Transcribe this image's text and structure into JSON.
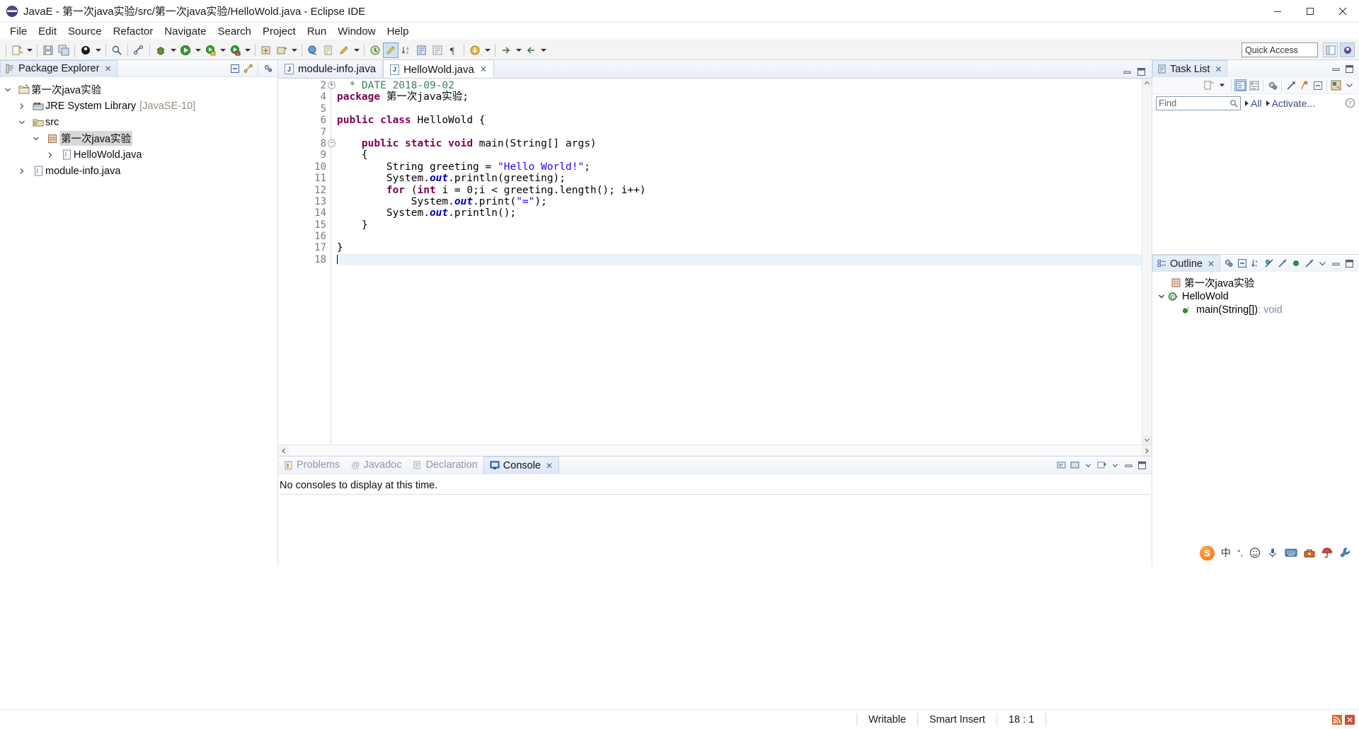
{
  "window": {
    "title": "JavaE - 第一次java实验/src/第一次java实验/HelloWold.java - Eclipse IDE",
    "minimize": "–",
    "maximize": "▢",
    "close": "✕"
  },
  "menubar": {
    "items": [
      "File",
      "Edit",
      "Source",
      "Refactor",
      "Navigate",
      "Search",
      "Project",
      "Run",
      "Window",
      "Help"
    ]
  },
  "toolbar": {
    "quick_access_placeholder": "Quick Access",
    "quick_access_value": "Quick Access"
  },
  "package_explorer": {
    "title": "Package Explorer",
    "close_mark": "✕",
    "tree": [
      {
        "label": "第一次java实验",
        "twist": "v",
        "icon": "java-project-icon",
        "indent": 1,
        "dim": "",
        "selected": false
      },
      {
        "label": "JRE System Library",
        "twist": ">",
        "icon": "library-icon",
        "indent": 2,
        "dim": "[JavaSE-10]",
        "selected": false
      },
      {
        "label": "src",
        "twist": "v",
        "icon": "source-folder-icon",
        "indent": 2,
        "dim": "",
        "selected": false
      },
      {
        "label": "第一次java实验",
        "twist": "v",
        "icon": "package-icon",
        "indent": 3,
        "dim": "",
        "selected": true
      },
      {
        "label": "HelloWold.java",
        "twist": ">",
        "icon": "java-file-icon",
        "indent": 4,
        "dim": "",
        "selected": false
      },
      {
        "label": "module-info.java",
        "twist": ">",
        "icon": "java-file-icon",
        "indent": 2,
        "dim": "",
        "selected": false
      }
    ]
  },
  "editor": {
    "tabs": [
      {
        "label": "module-info.java",
        "active": false,
        "close_mark": ""
      },
      {
        "label": "HelloWold.java",
        "active": true,
        "close_mark": "✕"
      }
    ],
    "lines": [
      {
        "num": "2",
        "fold": "⊕",
        "current": false,
        "tokens": [
          {
            "t": "  ",
            "c": "plain"
          },
          {
            "t": "* DATE 2018-09-02",
            "c": "cmt"
          }
        ]
      },
      {
        "num": "4",
        "fold": "",
        "current": false,
        "tokens": [
          {
            "t": "package",
            "c": "kw"
          },
          {
            "t": " 第一次java实验;",
            "c": "plain"
          }
        ]
      },
      {
        "num": "5",
        "fold": "",
        "current": false,
        "tokens": []
      },
      {
        "num": "6",
        "fold": "",
        "current": false,
        "tokens": [
          {
            "t": "public class",
            "c": "kw"
          },
          {
            "t": " HelloWold {",
            "c": "plain"
          }
        ]
      },
      {
        "num": "7",
        "fold": "",
        "current": false,
        "tokens": []
      },
      {
        "num": "8",
        "fold": "⊖",
        "current": false,
        "tokens": [
          {
            "t": "    ",
            "c": "plain"
          },
          {
            "t": "public static void",
            "c": "kw"
          },
          {
            "t": " main(String[] args)",
            "c": "plain"
          }
        ]
      },
      {
        "num": "9",
        "fold": "",
        "current": false,
        "tokens": [
          {
            "t": "    {",
            "c": "plain"
          }
        ]
      },
      {
        "num": "10",
        "fold": "",
        "current": false,
        "tokens": [
          {
            "t": "        String greeting = ",
            "c": "plain"
          },
          {
            "t": "\"Hello World!\"",
            "c": "str"
          },
          {
            "t": ";",
            "c": "plain"
          }
        ]
      },
      {
        "num": "11",
        "fold": "",
        "current": false,
        "tokens": [
          {
            "t": "        System.",
            "c": "plain"
          },
          {
            "t": "out",
            "c": "fld"
          },
          {
            "t": ".println(greeting);",
            "c": "plain"
          }
        ]
      },
      {
        "num": "12",
        "fold": "",
        "current": false,
        "tokens": [
          {
            "t": "        ",
            "c": "plain"
          },
          {
            "t": "for",
            "c": "kw"
          },
          {
            "t": " (",
            "c": "plain"
          },
          {
            "t": "int",
            "c": "kw"
          },
          {
            "t": " i = 0;i < greeting.length(); i++)",
            "c": "plain"
          }
        ]
      },
      {
        "num": "13",
        "fold": "",
        "current": false,
        "tokens": [
          {
            "t": "            System.",
            "c": "plain"
          },
          {
            "t": "out",
            "c": "fld"
          },
          {
            "t": ".print(",
            "c": "plain"
          },
          {
            "t": "\"=\"",
            "c": "str"
          },
          {
            "t": ");",
            "c": "plain"
          }
        ]
      },
      {
        "num": "14",
        "fold": "",
        "current": false,
        "tokens": [
          {
            "t": "        System.",
            "c": "plain"
          },
          {
            "t": "out",
            "c": "fld"
          },
          {
            "t": ".println();",
            "c": "plain"
          }
        ]
      },
      {
        "num": "15",
        "fold": "",
        "current": false,
        "tokens": [
          {
            "t": "    }",
            "c": "plain"
          }
        ]
      },
      {
        "num": "16",
        "fold": "",
        "current": false,
        "tokens": []
      },
      {
        "num": "17",
        "fold": "",
        "current": false,
        "tokens": [
          {
            "t": "}",
            "c": "plain"
          }
        ]
      },
      {
        "num": "18",
        "fold": "",
        "current": true,
        "tokens": []
      }
    ]
  },
  "console_panel": {
    "tabs": [
      {
        "label": "Problems",
        "active": false,
        "icon": "problems-icon"
      },
      {
        "label": "Javadoc",
        "active": false,
        "icon": "javadoc-icon"
      },
      {
        "label": "Declaration",
        "active": false,
        "icon": "declaration-icon"
      },
      {
        "label": "Console",
        "active": true,
        "icon": "console-icon"
      }
    ],
    "close_mark": "✕",
    "message": "No consoles to display at this time."
  },
  "task_list": {
    "title": "Task List",
    "close_mark": "✕",
    "find_placeholder": "Find",
    "all_label": "All",
    "activate_label": "Activate...",
    "help_mark": "?"
  },
  "outline": {
    "title": "Outline",
    "close_mark": "✕",
    "items": [
      {
        "label": "第一次java实验",
        "type": "package",
        "indent": 2,
        "twist": "",
        "suffix": ""
      },
      {
        "label": "HelloWold",
        "type": "class",
        "indent": 1,
        "twist": "v",
        "suffix": ""
      },
      {
        "label": "main(String[])",
        "type": "method",
        "indent": 3,
        "twist": "",
        "suffix": " : void"
      }
    ]
  },
  "ime": {
    "lang": "中",
    "punct": "°,"
  },
  "statusbar": {
    "writable": "Writable",
    "insert_mode": "Smart Insert",
    "position": "18 : 1"
  },
  "colors": {
    "keyword": "#7f0055",
    "string": "#2a00ff",
    "comment": "#3f7f5f",
    "field": "#0000c0",
    "selection": "#d8d8d8",
    "current_line": "#eaf2fb",
    "accent": "#3a4a7a"
  }
}
